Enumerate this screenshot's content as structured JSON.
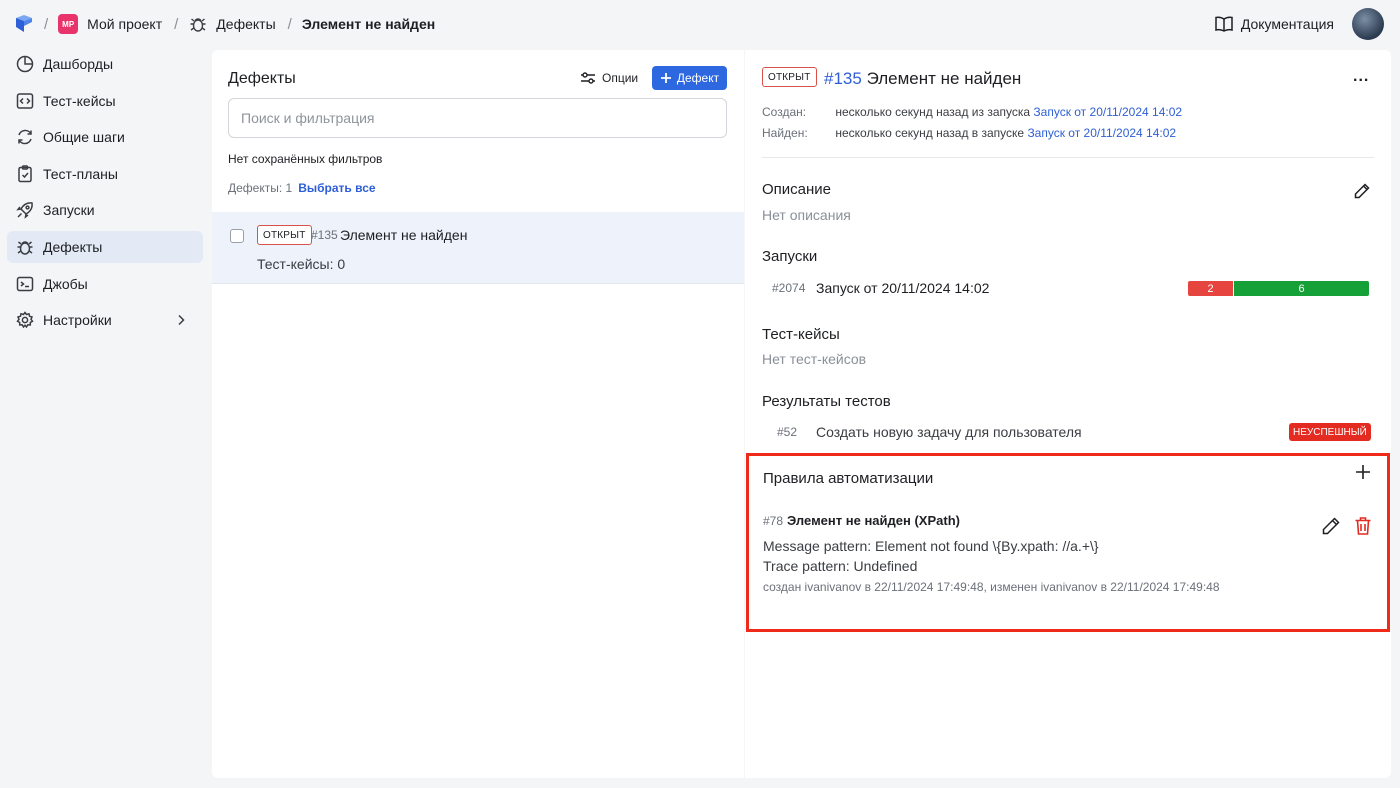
{
  "header": {
    "breadcrumbs": {
      "project_badge": "MP",
      "project": "Мой проект",
      "section": "Дефекты",
      "current": "Элемент не найден"
    },
    "docs_label": "Документация"
  },
  "sidebar": {
    "items": [
      {
        "label": "Дашборды",
        "icon": "pie-chart-icon"
      },
      {
        "label": "Тест-кейсы",
        "icon": "code-icon"
      },
      {
        "label": "Общие шаги",
        "icon": "refresh-icon"
      },
      {
        "label": "Тест-планы",
        "icon": "clipboard-icon"
      },
      {
        "label": "Запуски",
        "icon": "rocket-icon"
      },
      {
        "label": "Дефекты",
        "icon": "bug-icon",
        "active": true
      },
      {
        "label": "Джобы",
        "icon": "terminal-icon"
      },
      {
        "label": "Настройки",
        "icon": "gear-icon"
      }
    ]
  },
  "list": {
    "title": "Дефекты",
    "options_label": "Опции",
    "new_label": "Дефект",
    "search_placeholder": "Поиск и фильтрация",
    "no_filters": "Нет сохранённых фильтров",
    "count_label": "Дефекты: 1",
    "select_all": "Выбрать все",
    "rows": [
      {
        "status": "ОТКРЫТ",
        "id": "#135",
        "title": "Элемент не найден",
        "subtitle": "Тест-кейсы: 0"
      }
    ]
  },
  "detail": {
    "status": "ОТКРЫТ",
    "id": "#135",
    "title": "Элемент не найден",
    "more": "...",
    "created_label": "Создан:",
    "created_text": "несколько секунд назад из запуска",
    "created_link": "Запуск от 20/11/2024 14:02",
    "found_label": "Найден:",
    "found_text": "несколько секунд назад в запуске",
    "found_link": "Запуск от 20/11/2024 14:02",
    "description": {
      "heading": "Описание",
      "empty": "Нет описания"
    },
    "launches": {
      "heading": "Запуски",
      "items": [
        {
          "id": "#2074",
          "title": "Запуск от 20/11/2024 14:02",
          "failed": 2,
          "passed": 6
        }
      ]
    },
    "testcases": {
      "heading": "Тест-кейсы",
      "empty": "Нет тест-кейсов"
    },
    "results": {
      "heading": "Результаты тестов",
      "items": [
        {
          "id": "#52",
          "title": "Создать новую задачу для пользователя",
          "status": "НЕУСПЕШНЫЙ"
        }
      ]
    },
    "automation": {
      "heading": "Правила автоматизации",
      "rules": [
        {
          "id": "#78",
          "title": "Элемент не найден (XPath)",
          "message": "Message pattern: Element not found \\{By.xpath: //a.+\\}",
          "trace": "Trace pattern: Undefined",
          "footer": "создан ivanivanov в 22/11/2024 17:49:48, изменен ivanivanov в 22/11/2024 17:49:48"
        }
      ]
    }
  },
  "colors": {
    "accent": "#2e68e0",
    "fail": "#e5443f",
    "pass": "#16a138",
    "highlight": "#f02a18"
  }
}
